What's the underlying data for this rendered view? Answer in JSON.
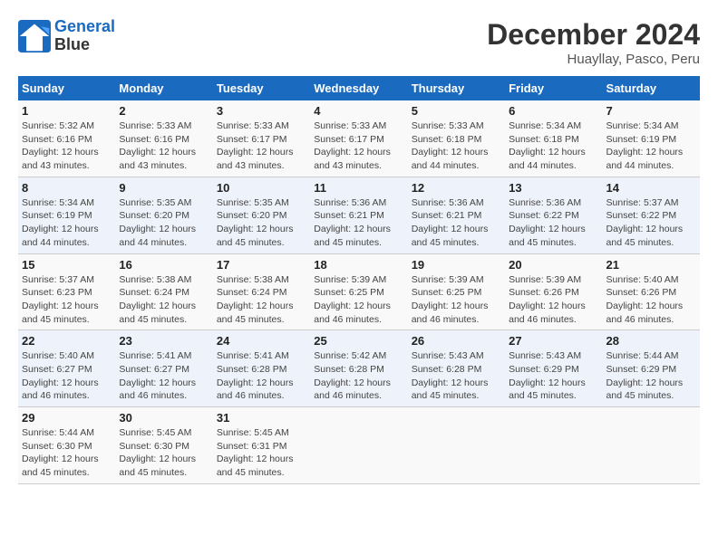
{
  "header": {
    "logo_line1": "General",
    "logo_line2": "Blue",
    "month_title": "December 2024",
    "subtitle": "Huayllay, Pasco, Peru"
  },
  "days_of_week": [
    "Sunday",
    "Monday",
    "Tuesday",
    "Wednesday",
    "Thursday",
    "Friday",
    "Saturday"
  ],
  "weeks": [
    [
      {
        "day": "1",
        "detail": "Sunrise: 5:32 AM\nSunset: 6:16 PM\nDaylight: 12 hours\nand 43 minutes."
      },
      {
        "day": "2",
        "detail": "Sunrise: 5:33 AM\nSunset: 6:16 PM\nDaylight: 12 hours\nand 43 minutes."
      },
      {
        "day": "3",
        "detail": "Sunrise: 5:33 AM\nSunset: 6:17 PM\nDaylight: 12 hours\nand 43 minutes."
      },
      {
        "day": "4",
        "detail": "Sunrise: 5:33 AM\nSunset: 6:17 PM\nDaylight: 12 hours\nand 43 minutes."
      },
      {
        "day": "5",
        "detail": "Sunrise: 5:33 AM\nSunset: 6:18 PM\nDaylight: 12 hours\nand 44 minutes."
      },
      {
        "day": "6",
        "detail": "Sunrise: 5:34 AM\nSunset: 6:18 PM\nDaylight: 12 hours\nand 44 minutes."
      },
      {
        "day": "7",
        "detail": "Sunrise: 5:34 AM\nSunset: 6:19 PM\nDaylight: 12 hours\nand 44 minutes."
      }
    ],
    [
      {
        "day": "8",
        "detail": "Sunrise: 5:34 AM\nSunset: 6:19 PM\nDaylight: 12 hours\nand 44 minutes."
      },
      {
        "day": "9",
        "detail": "Sunrise: 5:35 AM\nSunset: 6:20 PM\nDaylight: 12 hours\nand 44 minutes."
      },
      {
        "day": "10",
        "detail": "Sunrise: 5:35 AM\nSunset: 6:20 PM\nDaylight: 12 hours\nand 45 minutes."
      },
      {
        "day": "11",
        "detail": "Sunrise: 5:36 AM\nSunset: 6:21 PM\nDaylight: 12 hours\nand 45 minutes."
      },
      {
        "day": "12",
        "detail": "Sunrise: 5:36 AM\nSunset: 6:21 PM\nDaylight: 12 hours\nand 45 minutes."
      },
      {
        "day": "13",
        "detail": "Sunrise: 5:36 AM\nSunset: 6:22 PM\nDaylight: 12 hours\nand 45 minutes."
      },
      {
        "day": "14",
        "detail": "Sunrise: 5:37 AM\nSunset: 6:22 PM\nDaylight: 12 hours\nand 45 minutes."
      }
    ],
    [
      {
        "day": "15",
        "detail": "Sunrise: 5:37 AM\nSunset: 6:23 PM\nDaylight: 12 hours\nand 45 minutes."
      },
      {
        "day": "16",
        "detail": "Sunrise: 5:38 AM\nSunset: 6:24 PM\nDaylight: 12 hours\nand 45 minutes."
      },
      {
        "day": "17",
        "detail": "Sunrise: 5:38 AM\nSunset: 6:24 PM\nDaylight: 12 hours\nand 45 minutes."
      },
      {
        "day": "18",
        "detail": "Sunrise: 5:39 AM\nSunset: 6:25 PM\nDaylight: 12 hours\nand 46 minutes."
      },
      {
        "day": "19",
        "detail": "Sunrise: 5:39 AM\nSunset: 6:25 PM\nDaylight: 12 hours\nand 46 minutes."
      },
      {
        "day": "20",
        "detail": "Sunrise: 5:39 AM\nSunset: 6:26 PM\nDaylight: 12 hours\nand 46 minutes."
      },
      {
        "day": "21",
        "detail": "Sunrise: 5:40 AM\nSunset: 6:26 PM\nDaylight: 12 hours\nand 46 minutes."
      }
    ],
    [
      {
        "day": "22",
        "detail": "Sunrise: 5:40 AM\nSunset: 6:27 PM\nDaylight: 12 hours\nand 46 minutes."
      },
      {
        "day": "23",
        "detail": "Sunrise: 5:41 AM\nSunset: 6:27 PM\nDaylight: 12 hours\nand 46 minutes."
      },
      {
        "day": "24",
        "detail": "Sunrise: 5:41 AM\nSunset: 6:28 PM\nDaylight: 12 hours\nand 46 minutes."
      },
      {
        "day": "25",
        "detail": "Sunrise: 5:42 AM\nSunset: 6:28 PM\nDaylight: 12 hours\nand 46 minutes."
      },
      {
        "day": "26",
        "detail": "Sunrise: 5:43 AM\nSunset: 6:28 PM\nDaylight: 12 hours\nand 45 minutes."
      },
      {
        "day": "27",
        "detail": "Sunrise: 5:43 AM\nSunset: 6:29 PM\nDaylight: 12 hours\nand 45 minutes."
      },
      {
        "day": "28",
        "detail": "Sunrise: 5:44 AM\nSunset: 6:29 PM\nDaylight: 12 hours\nand 45 minutes."
      }
    ],
    [
      {
        "day": "29",
        "detail": "Sunrise: 5:44 AM\nSunset: 6:30 PM\nDaylight: 12 hours\nand 45 minutes."
      },
      {
        "day": "30",
        "detail": "Sunrise: 5:45 AM\nSunset: 6:30 PM\nDaylight: 12 hours\nand 45 minutes."
      },
      {
        "day": "31",
        "detail": "Sunrise: 5:45 AM\nSunset: 6:31 PM\nDaylight: 12 hours\nand 45 minutes."
      },
      {
        "day": "",
        "detail": ""
      },
      {
        "day": "",
        "detail": ""
      },
      {
        "day": "",
        "detail": ""
      },
      {
        "day": "",
        "detail": ""
      }
    ]
  ]
}
